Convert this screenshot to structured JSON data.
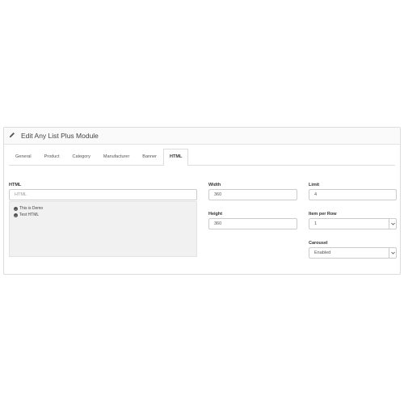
{
  "panel": {
    "title": "Edit Any List Plus Module",
    "icon": "pencil-icon"
  },
  "tabs": [
    {
      "label": "General",
      "active": false
    },
    {
      "label": "Product",
      "active": false
    },
    {
      "label": "Category",
      "active": false
    },
    {
      "label": "Manufacturer",
      "active": false
    },
    {
      "label": "Banner",
      "active": false
    },
    {
      "label": "HTML",
      "active": true
    }
  ],
  "html_field": {
    "label": "HTML",
    "placeholder": "HTML",
    "items": [
      "This is Demo",
      "Test HTML"
    ]
  },
  "width_field": {
    "label": "Width",
    "value": "360"
  },
  "height_field": {
    "label": "Height",
    "value": "360"
  },
  "limit_field": {
    "label": "Limit",
    "value": "4"
  },
  "item_per_row_field": {
    "label": "Item per Row",
    "value": "1"
  },
  "carousel_field": {
    "label": "Carousel",
    "value": "Enabled"
  }
}
